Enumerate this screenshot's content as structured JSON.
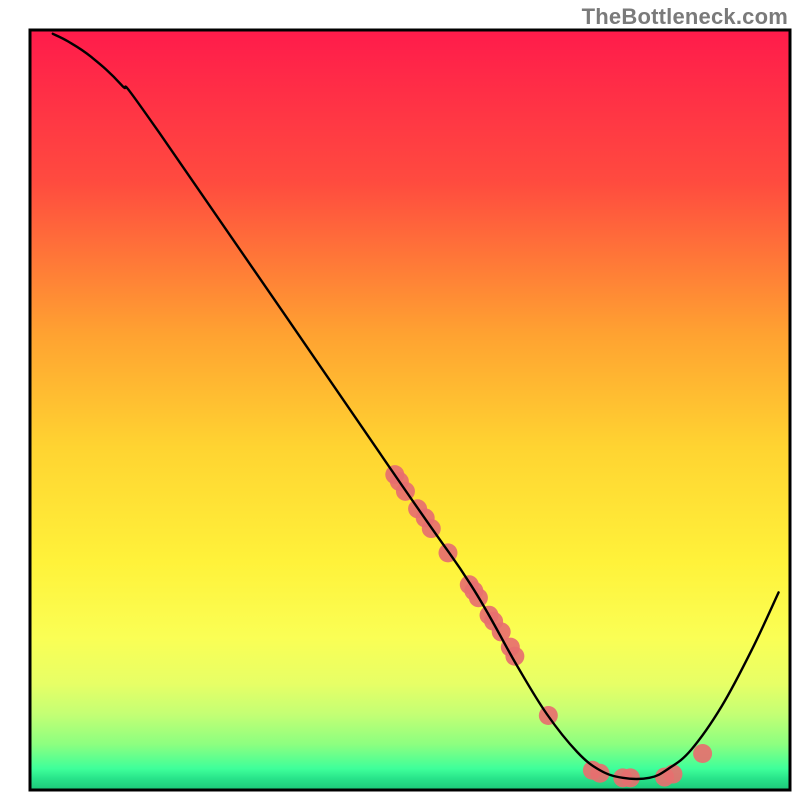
{
  "watermark": "TheBottleneck.com",
  "chart_data": {
    "type": "line",
    "title": "",
    "xlabel": "",
    "ylabel": "",
    "x_range": [
      0,
      100
    ],
    "y_range": [
      0,
      100
    ],
    "grid": false,
    "legend": false,
    "gradient_bands": {
      "description": "Vertical color gradient background from top to bottom",
      "stops": [
        {
          "offset": 0.0,
          "color": "#ff1b4b"
        },
        {
          "offset": 0.2,
          "color": "#ff4b3f"
        },
        {
          "offset": 0.4,
          "color": "#ffa231"
        },
        {
          "offset": 0.55,
          "color": "#ffd431"
        },
        {
          "offset": 0.7,
          "color": "#fff23a"
        },
        {
          "offset": 0.8,
          "color": "#faff55"
        },
        {
          "offset": 0.86,
          "color": "#e7ff66"
        },
        {
          "offset": 0.9,
          "color": "#c4ff74"
        },
        {
          "offset": 0.94,
          "color": "#8cff80"
        },
        {
          "offset": 0.972,
          "color": "#3eff9a"
        },
        {
          "offset": 0.985,
          "color": "#28e38a"
        },
        {
          "offset": 1.0,
          "color": "#1cc779"
        }
      ]
    },
    "series": [
      {
        "name": "curve",
        "type": "curve",
        "color": "#000000",
        "stroke_width": 2.4,
        "points_xy": [
          [
            3.0,
            99.5
          ],
          [
            5.0,
            98.5
          ],
          [
            8.0,
            96.5
          ],
          [
            12.0,
            92.8
          ],
          [
            17.0,
            86.5
          ],
          [
            49.0,
            40.0
          ],
          [
            58.0,
            27.0
          ],
          [
            64.0,
            16.5
          ],
          [
            68.0,
            10.0
          ],
          [
            72.0,
            5.0
          ],
          [
            75.0,
            2.6
          ],
          [
            78.0,
            1.6
          ],
          [
            81.5,
            1.6
          ],
          [
            84.0,
            2.8
          ],
          [
            87.0,
            5.3
          ],
          [
            91.0,
            11.0
          ],
          [
            95.0,
            18.5
          ],
          [
            98.5,
            26.0
          ]
        ]
      },
      {
        "name": "dots",
        "type": "scatter",
        "color": "#e76f6f",
        "r": 9.5,
        "points_xy": [
          [
            48.0,
            41.5
          ],
          [
            48.6,
            40.6
          ],
          [
            49.4,
            39.3
          ],
          [
            51.0,
            37.0
          ],
          [
            52.0,
            35.8
          ],
          [
            52.8,
            34.4
          ],
          [
            55.0,
            31.2
          ],
          [
            57.8,
            27.0
          ],
          [
            58.4,
            26.2
          ],
          [
            59.0,
            25.3
          ],
          [
            60.4,
            23.0
          ],
          [
            61.0,
            22.2
          ],
          [
            62.0,
            20.8
          ],
          [
            63.2,
            18.8
          ],
          [
            63.8,
            17.6
          ],
          [
            68.2,
            9.8
          ],
          [
            74.0,
            2.6
          ],
          [
            75.0,
            2.2
          ],
          [
            78.0,
            1.6
          ],
          [
            79.0,
            1.6
          ],
          [
            83.5,
            1.7
          ],
          [
            84.6,
            2.1
          ],
          [
            88.5,
            4.8
          ]
        ]
      }
    ]
  }
}
